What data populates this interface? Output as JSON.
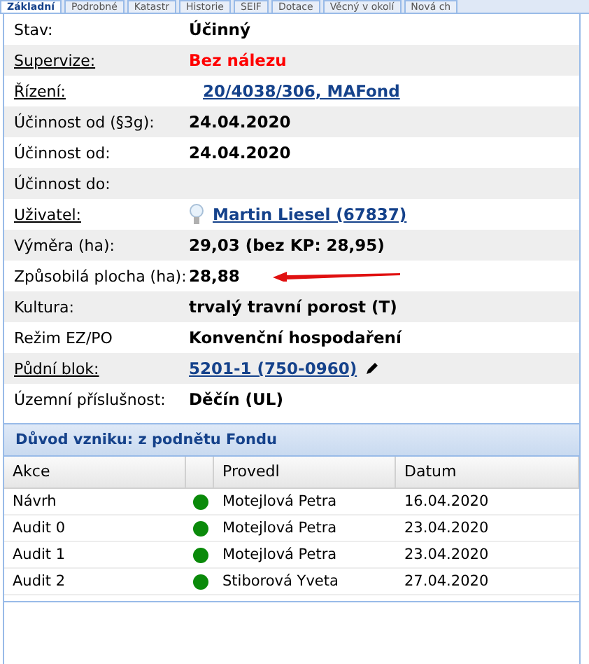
{
  "tabs": [
    {
      "label": "Základní",
      "selected": true
    },
    {
      "label": "Podrobné",
      "selected": false
    },
    {
      "label": "Katastr",
      "selected": false
    },
    {
      "label": "Historie",
      "selected": false
    },
    {
      "label": "SEIF",
      "selected": false
    },
    {
      "label": "Dotace",
      "selected": false
    },
    {
      "label": "Věcný v okolí",
      "selected": false
    },
    {
      "label": "Nová ch",
      "selected": false
    }
  ],
  "fields": [
    {
      "label": "Stav:",
      "value": "Účinný",
      "kind": "text",
      "label_link": false
    },
    {
      "label": "Supervize:",
      "value": "Bez nálezu",
      "kind": "alert",
      "label_link": true
    },
    {
      "label": "Řízení:",
      "value": "20/4038/306, MAFond",
      "kind": "link",
      "label_link": true
    },
    {
      "label": "Účinnost od (§3g):",
      "value": "24.04.2020",
      "kind": "text",
      "label_link": false
    },
    {
      "label": "Účinnost od:",
      "value": "24.04.2020",
      "kind": "text",
      "label_link": false
    },
    {
      "label": "Účinnost do:",
      "kind": "text",
      "label_link": false
    },
    {
      "label": "Uživatel:",
      "value": "Martin Liesel (67837)",
      "kind": "user",
      "label_link": true
    },
    {
      "label": "Výměra (ha):",
      "value": "29,03 (bez KP: 28,95)",
      "kind": "text",
      "label_link": false
    },
    {
      "label": "Způsobilá plocha (ha):",
      "value": "28,88",
      "kind": "arrow",
      "label_link": false
    },
    {
      "label": "Kultura:",
      "value": "trvalý travní porost (T)",
      "kind": "text",
      "label_link": false
    },
    {
      "label": "Režim EZ/PO",
      "value": "Konvenční hospodaření",
      "kind": "text",
      "label_link": false
    },
    {
      "label": "Půdní blok:",
      "value": "5201-1 (750-0960)",
      "kind": "editlink",
      "label_link": true
    },
    {
      "label": "Územní příslušnost:",
      "value": "Děčín (UL)",
      "kind": "text",
      "label_link": false
    }
  ],
  "section": {
    "title": "Důvod vzniku: z podnětu Fondu"
  },
  "table": {
    "columns": [
      "Akce",
      "Provedl",
      "Datum"
    ],
    "rows": [
      {
        "akce": "Návrh",
        "color": "#0a8a0a",
        "provedl": "Motejlová Petra",
        "datum": "16.04.2020"
      },
      {
        "akce": "Audit 0",
        "color": "#0a8a0a",
        "provedl": "Motejlová Petra",
        "datum": "23.04.2020"
      },
      {
        "akce": "Audit 1",
        "color": "#0a8a0a",
        "provedl": "Motejlová Petra",
        "datum": "23.04.2020"
      },
      {
        "akce": "Audit 2",
        "color": "#0a8a0a",
        "provedl": "Stiborová Yveta",
        "datum": "27.04.2020"
      }
    ]
  }
}
